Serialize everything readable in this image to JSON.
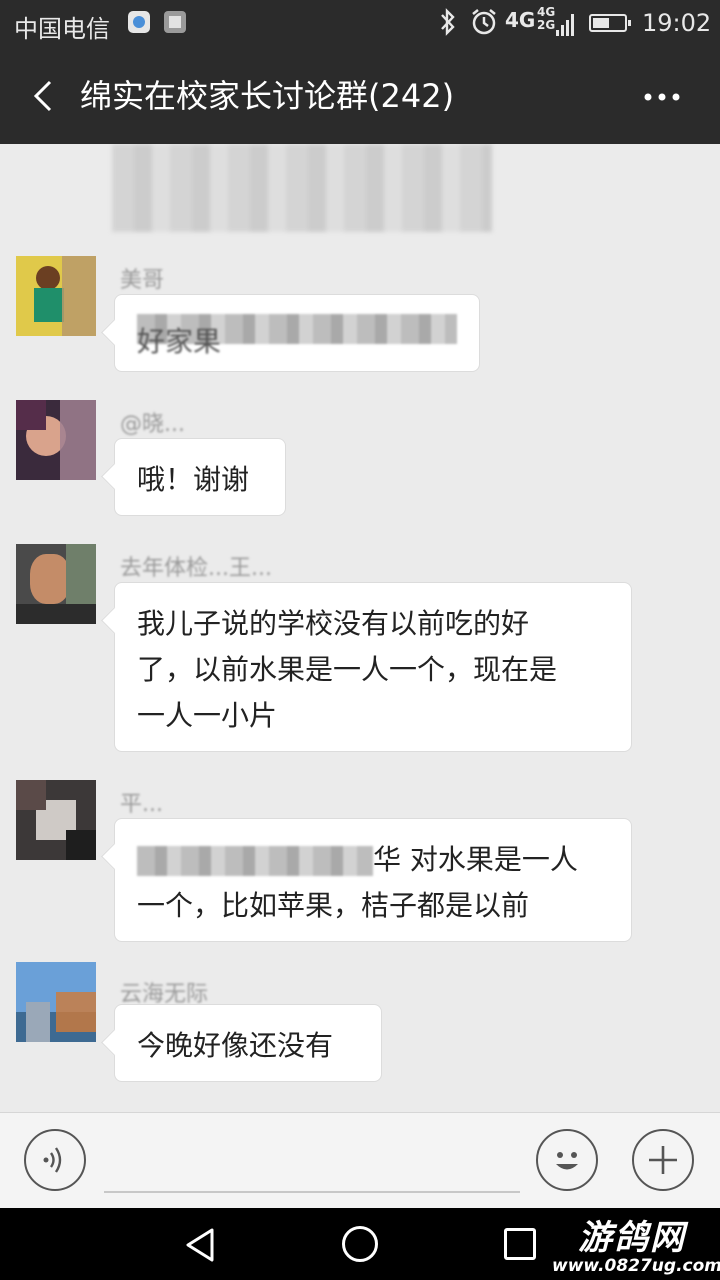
{
  "status_bar": {
    "carrier": "中国电信",
    "network_type": "4G",
    "network_sub_top": "4G",
    "network_sub_bottom": "2G",
    "time": "19:02",
    "icons": [
      "bluetooth-icon",
      "alarm-icon",
      "signal-icon",
      "battery-icon"
    ]
  },
  "header": {
    "title": "绵实在校家长讨论群(242)",
    "back_icon": "chevron-left-icon",
    "more_icon": "more-dots-icon"
  },
  "messages": [
    {
      "sender": "美哥",
      "text_visible_end": "好家果"
    },
    {
      "sender": "@晓...",
      "text": "哦！谢谢"
    },
    {
      "sender": "去年体检...王...",
      "text": "我儿子说的学校没有以前吃的好了，以前水果是一人一个，现在是一人一小片",
      "lines": [
        "我儿子说的学校没有以前吃的好",
        "了，以前水果是一人一个，现在是",
        "一人一小片"
      ]
    },
    {
      "sender": "平...",
      "text_visible_end": "华  对水果是一人",
      "line2": "一个，比如苹果，桔子都是以前"
    },
    {
      "sender": "云海无际",
      "text": "今晚好像还没有"
    }
  ],
  "input_bar": {
    "voice_icon": "voice-icon",
    "emoji_icon": "emoji-icon",
    "add_icon": "plus-icon"
  },
  "nav_bar": {
    "icons": [
      "nav-back-icon",
      "nav-home-icon",
      "nav-recent-icon"
    ]
  },
  "watermark": {
    "title": "游鸽网",
    "url": "www.0827ug.com"
  }
}
